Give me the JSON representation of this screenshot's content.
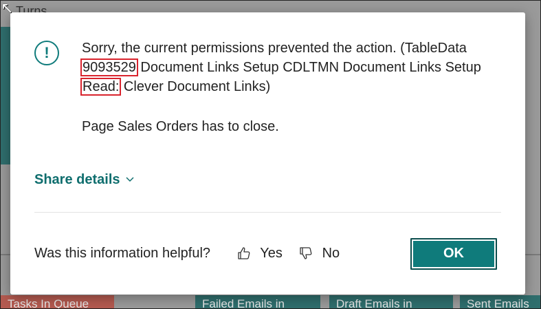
{
  "background": {
    "page_title": "Turns",
    "cards": [
      "Tasks In Queue",
      "Failed Emails in",
      "Draft Emails in",
      "Sent Emails"
    ]
  },
  "dialog": {
    "message_prefix": "Sorry, the current permissions prevented the action. (TableData ",
    "highlight_1": "9093529",
    "message_middle": " Document Links Setup CDLTMN Document Links Setup ",
    "highlight_2": "Read:",
    "message_suffix": " Clever Document Links)",
    "message_secondary": "Page Sales Orders has to close.",
    "share_details_label": "Share details",
    "helpful_question": "Was this information helpful?",
    "yes_label": "Yes",
    "no_label": "No",
    "ok_label": "OK",
    "icon": "info-circle-icon"
  },
  "colors": {
    "accent": "#0f7b7b",
    "highlight": "#d9232d"
  }
}
